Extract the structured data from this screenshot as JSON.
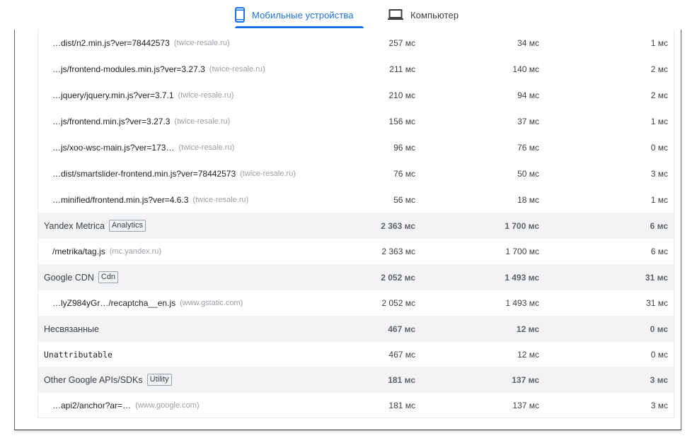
{
  "tabs": {
    "mobile_label": "Мобильные устройства",
    "desktop_label": "Компьютер",
    "active": "mobile",
    "accent_color": "#1a73e8",
    "mobile_icon": "smartphone-icon",
    "desktop_icon": "laptop-icon"
  },
  "rows": [
    {
      "type": "child",
      "name": "…dist/n2.min.js?ver=78442573",
      "domain": "(twice-resale.ru)",
      "c1": "257 мс",
      "c2": "34 мс",
      "c3": "1 мс"
    },
    {
      "type": "child",
      "name": "…js/frontend-modules.min.js?ver=3.27.3",
      "domain": "(twice-resale.ru)",
      "c1": "211 мс",
      "c2": "140 мс",
      "c3": "2 мс"
    },
    {
      "type": "child",
      "name": "…jquery/jquery.min.js?ver=3.7.1",
      "domain": "(twice-resale.ru)",
      "c1": "210 мс",
      "c2": "94 мс",
      "c3": "2 мс"
    },
    {
      "type": "child",
      "name": "…js/frontend.min.js?ver=3.27.3",
      "domain": "(twice-resale.ru)",
      "c1": "156 мс",
      "c2": "37 мс",
      "c3": "1 мс"
    },
    {
      "type": "child",
      "name": "…js/xoo-wsc-main.js?ver=173…",
      "domain": "(twice-resale.ru)",
      "c1": "96 мс",
      "c2": "76 мс",
      "c3": "0 мс"
    },
    {
      "type": "child",
      "name": "…dist/smartslider-frontend.min.js?ver=78442573",
      "domain": "(twice-resale.ru)",
      "c1": "76 мс",
      "c2": "50 мс",
      "c3": "3 мс"
    },
    {
      "type": "child",
      "name": "…minified/frontend.min.js?ver=4.6.3",
      "domain": "(twice-resale.ru)",
      "c1": "56 мс",
      "c2": "18 мс",
      "c3": "1 мс"
    },
    {
      "type": "group",
      "name": "Yandex Metrica",
      "badge": "Analytics",
      "c1": "2 363 мс",
      "c2": "1 700 мс",
      "c3": "6 мс"
    },
    {
      "type": "child",
      "name": "/metrika/tag.js",
      "domain": "(mc.yandex.ru)",
      "c1": "2 363 мс",
      "c2": "1 700 мс",
      "c3": "6 мс"
    },
    {
      "type": "group",
      "name": "Google CDN",
      "badge": "Cdn",
      "c1": "2 052 мс",
      "c2": "1 493 мс",
      "c3": "31 мс"
    },
    {
      "type": "child",
      "name": "…lyZ984yGr…/recaptcha__en.js",
      "domain": "(www.gstatic.com)",
      "c1": "2 052 мс",
      "c2": "1 493 мс",
      "c3": "31 мс"
    },
    {
      "type": "group",
      "name": "Несвязанные",
      "c1": "467 мс",
      "c2": "12 мс",
      "c3": "0 мс"
    },
    {
      "type": "plain",
      "name": "Unattributable",
      "c1": "467 мс",
      "c2": "12 мс",
      "c3": "0 мс"
    },
    {
      "type": "group",
      "name": "Other Google APIs/SDKs",
      "badge": "Utility",
      "c1": "181 мс",
      "c2": "137 мс",
      "c3": "3 мс"
    },
    {
      "type": "child",
      "name": "…api2/anchor?ar=…",
      "domain": "(www.google.com)",
      "c1": "181 мс",
      "c2": "137 мс",
      "c3": "3 мс"
    }
  ]
}
